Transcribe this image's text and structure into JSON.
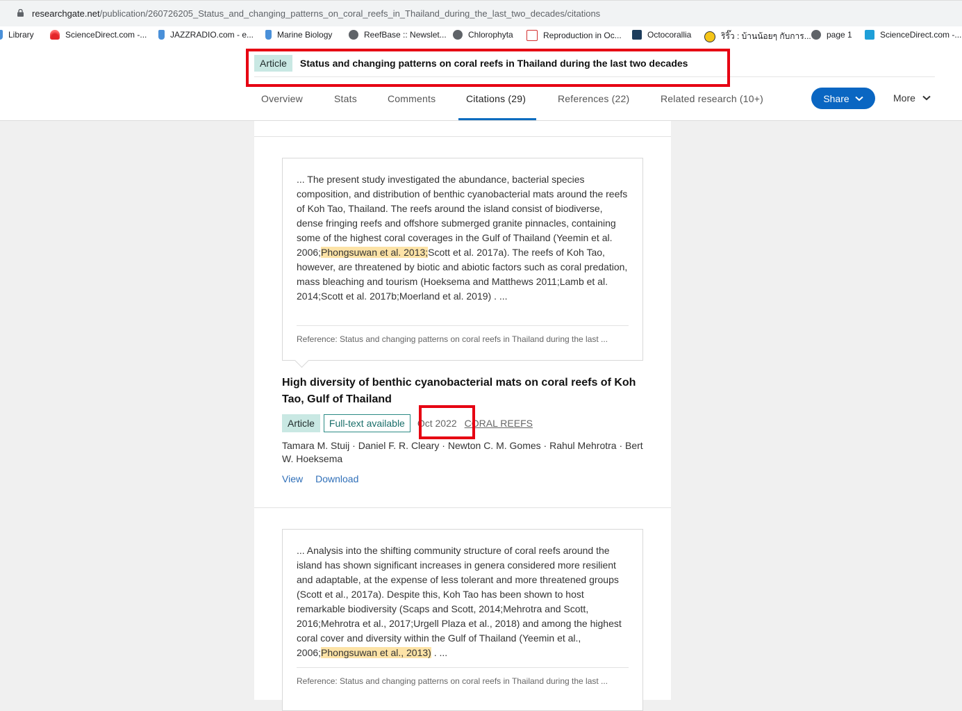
{
  "browser": {
    "url_host": "researchgate.net",
    "url_path": "/publication/260726205_Status_and_changing_patterns_on_coral_reefs_in_Thailand_during_the_last_two_decades/citations",
    "bookmarks": [
      "Library",
      "ScienceDirect.com -...",
      "JAZZRADIO.com - e...",
      "Marine Biology",
      "ReefBase :: Newslet...",
      "Chlorophyta",
      "Reproduction in Oc...",
      "Octocorallia",
      "ริริ๊ว : บ้านน้อยๆ กับการ...",
      "page 1",
      "ScienceDirect.com -..."
    ]
  },
  "header": {
    "badge": "Article",
    "title": "Status and changing patterns on coral reefs in Thailand during the last two decades",
    "tabs": [
      "Overview",
      "Stats",
      "Comments",
      "Citations (29)",
      "References (22)",
      "Related research (10+)"
    ],
    "active_tab": "Citations (29)",
    "share_label": "Share",
    "more_label": "More"
  },
  "citations": [
    {
      "snippet_parts": [
        "... The present study investigated the abundance, bacterial species composition, and distribution of benthic cyanobacterial mats around the reefs of Koh Tao, Thailand. The reefs around the island consist of biodiverse, dense fringing reefs and offshore submerged granite pinnacles, containing some of the highest coral coverages in the Gulf of Thailand (Yeemin et al. 2006;",
        "Phongsuwan et al. 2013;",
        "Scott et al. 2017a). The reefs of Koh Tao, however, are threatened by biotic and abiotic factors such as coral predation, mass bleaching and tourism (Hoeksema and Matthews 2011;Lamb et al. 2014;Scott et al. 2017b;Moerland et al. 2019) . ..."
      ],
      "reference": "Reference: Status and changing patterns on coral reefs in Thailand during the last ...",
      "title": "High diversity of benthic cyanobacterial mats on coral reefs of Koh Tao, Gulf of Thailand",
      "type": "Article",
      "fulltext": "Full-text available",
      "date": "Oct 2022",
      "journal": "CORAL REEFS",
      "authors": "Tamara M. Stuij · Daniel F. R. Cleary · Newton C. M. Gomes · Rahul Mehrotra · Bert W. Hoeksema",
      "view_label": "View",
      "download_label": "Download"
    },
    {
      "snippet_parts": [
        "... Analysis into the shifting community structure of coral reefs around the island has shown significant increases in genera considered more resilient and adaptable, at the expense of less tolerant and more threatened groups (Scott et al., 2017a). Despite this, Koh Tao has been shown to host remarkable biodiversity (Scaps and Scott, 2014;Mehrotra and Scott, 2016;Mehrotra et al., 2017;Urgell Plaza et al., 2018) and among the highest coral cover and diversity within the Gulf of Thailand (Yeemin et al., 2006;",
        "Phongsuwan et al., 2013)",
        ". ..."
      ],
      "reference": "Reference: Status and changing patterns on coral reefs in Thailand during the last ..."
    }
  ],
  "colors": {
    "accent_blue": "#0a66c2",
    "badge_teal": "#c9e8e3",
    "highlight": "#fde3a7",
    "annotation_red": "#e60012"
  }
}
